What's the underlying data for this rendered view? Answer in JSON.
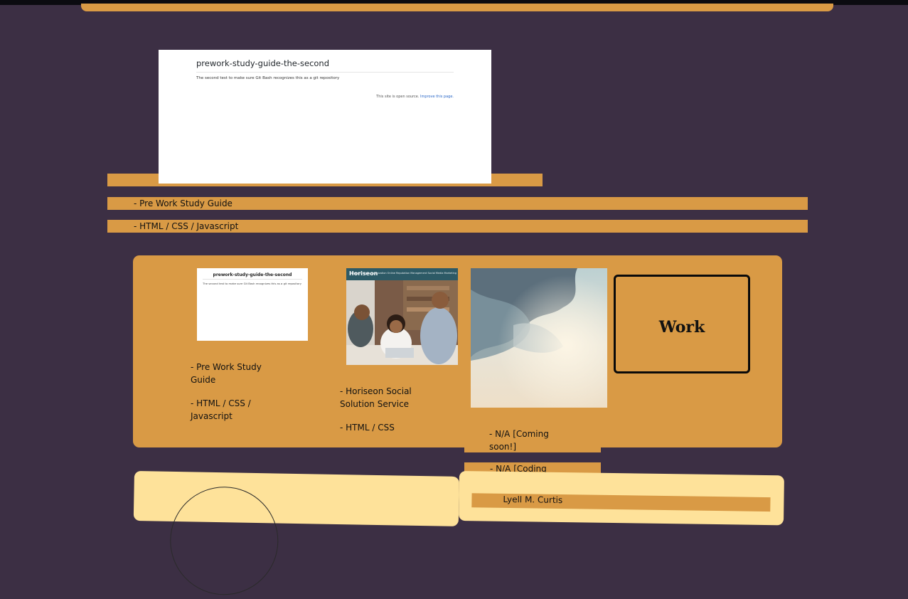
{
  "hero": {
    "screenshot_title": "prework-study-guide-the-second",
    "screenshot_text": "The second test to make sure Git Bash recognizes this as a git repository",
    "screenshot_footer": "This site is open source.",
    "screenshot_footer_link": "Improve this page.",
    "project_name": "- Pre Work Study Guide",
    "project_tech": "- HTML / CSS / Javascript"
  },
  "projects": [
    {
      "thumb_title": "prework-study-guide-the-second",
      "thumb_text": "The second test to make sure Git Bash recognizes this as a git repository",
      "name": "- Pre Work Study Guide",
      "tech": "- HTML / CSS / Javascript"
    },
    {
      "thumb_brand": "Horiseon",
      "thumb_links": "Search Engine Optimization   Online Reputation Management   Social Media Marketing",
      "name": "- Horiseon Social Solution Service",
      "tech": "- HTML / CSS"
    },
    {
      "name": "- N/A [Coming soon!]",
      "tech": "- N/A [Coding"
    }
  ],
  "work_box": {
    "title": "Work"
  },
  "about": {
    "name": "Lyell M. Curtis"
  },
  "colors": {
    "background": "#3c2f44",
    "accent": "#d99a45",
    "card": "#fee29a"
  }
}
